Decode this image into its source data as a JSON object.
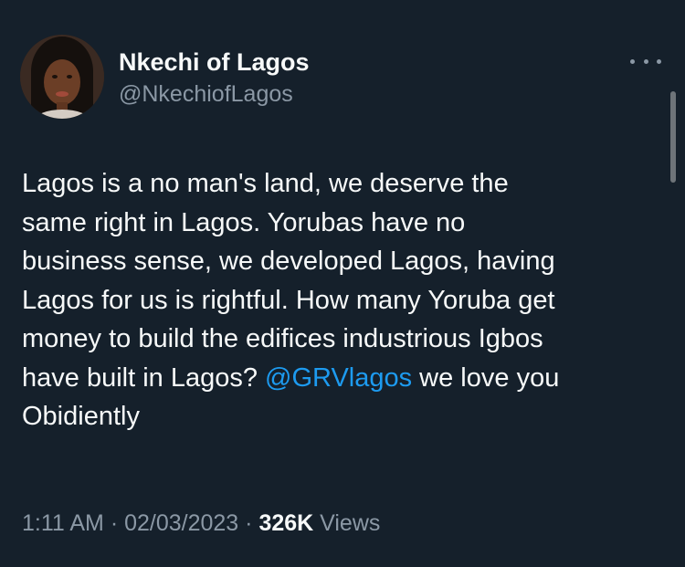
{
  "tweet": {
    "author": {
      "display_name": "Nkechi of Lagos",
      "handle": "@NkechiofLagos"
    },
    "more_icon": "more-horizontal-icon",
    "text_lines": [
      "Lagos is a no man's land, we deserve the",
      "same right in Lagos. Yorubas have no",
      "business sense, we developed Lagos, having",
      "Lagos for us is rightful. How many Yoruba get",
      "money to build the edifices industrious Igbos"
    ],
    "line6_before": "have built in Lagos? ",
    "mention": "@GRVlagos",
    "line6_after": " we love you",
    "line7": "Obidiently",
    "time": "1:11 AM",
    "separator": " · ",
    "date": "02/03/2023",
    "views_count": "326K",
    "views_label": " Views"
  },
  "colors": {
    "background": "#15202b",
    "text": "#f7f9f9",
    "secondary": "#8b98a5",
    "link": "#1d9bf0"
  }
}
